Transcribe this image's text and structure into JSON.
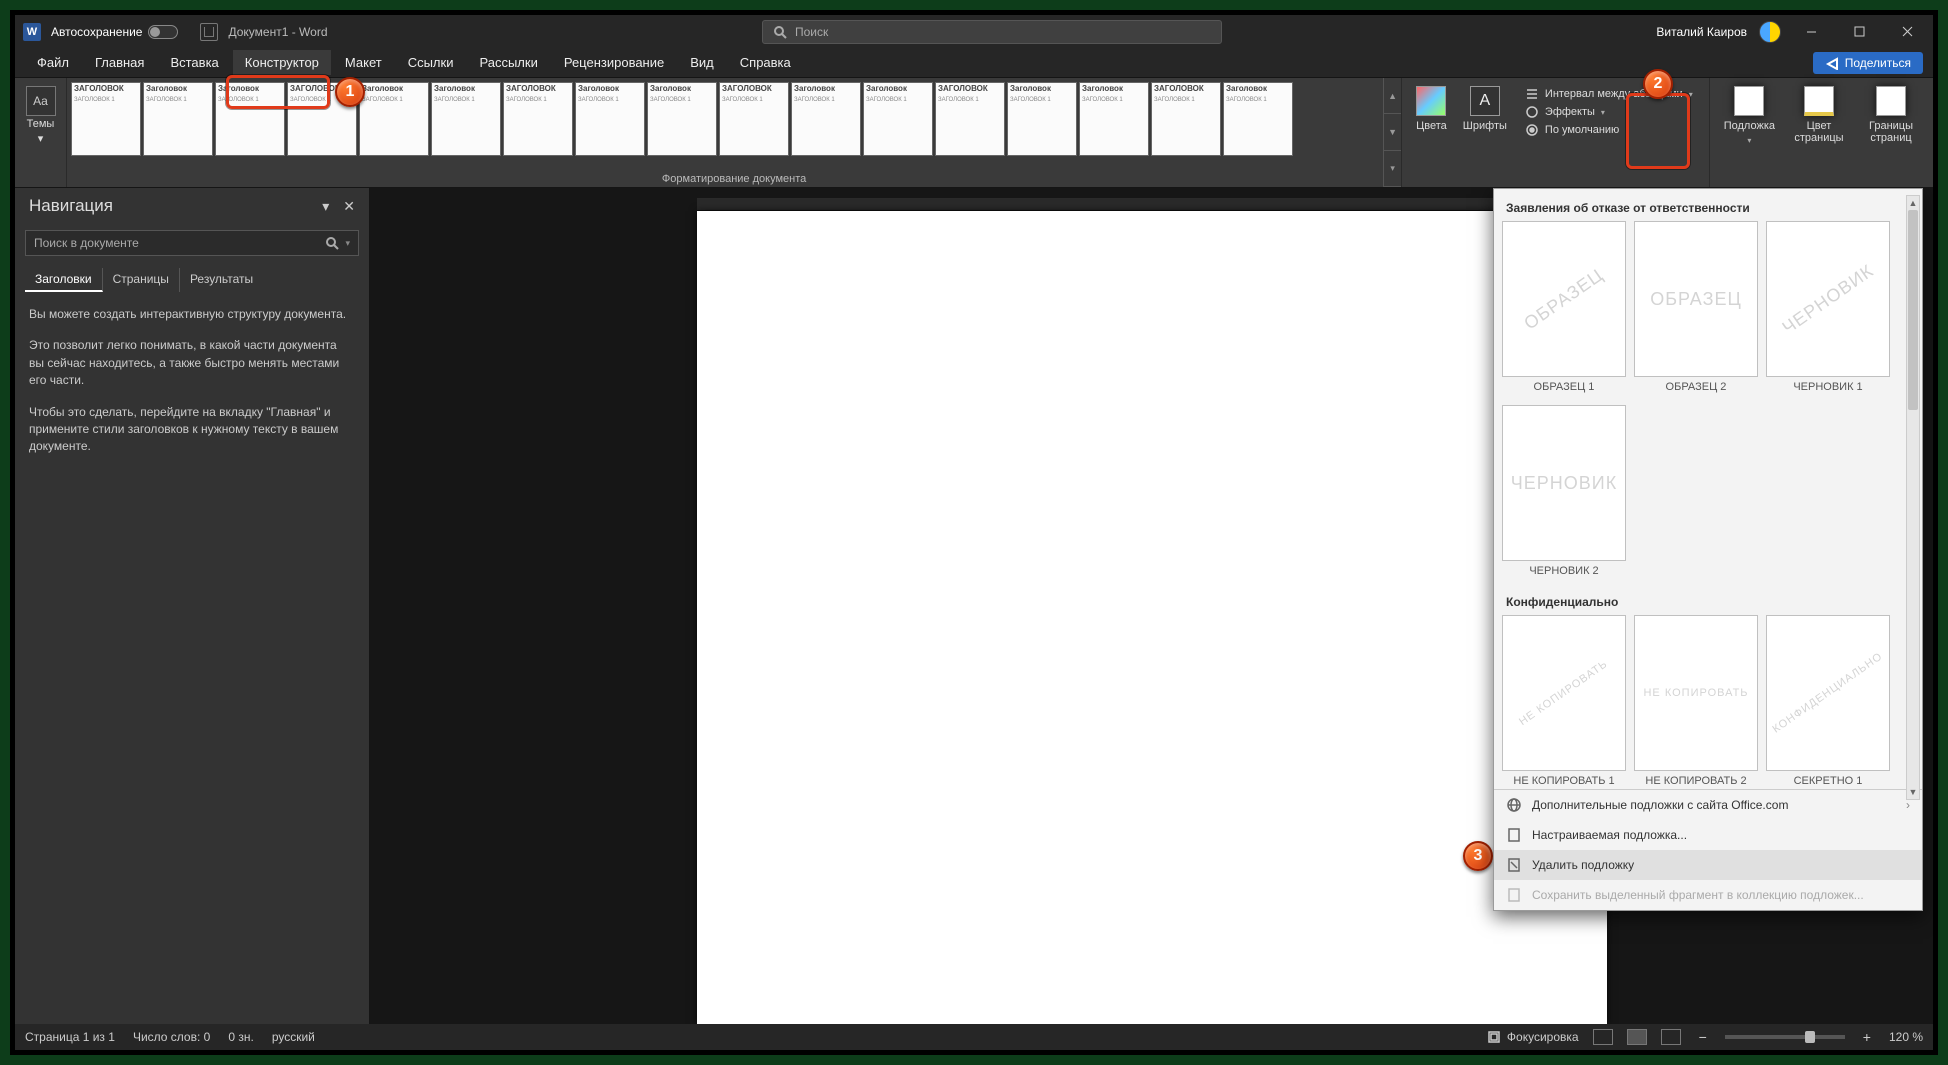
{
  "titlebar": {
    "autosave_label": "Автосохранение",
    "doc_title": "Документ1 - Word",
    "search_placeholder": "Поиск",
    "user_name": "Виталий Каиров"
  },
  "tabs": {
    "file": "Файл",
    "home": "Главная",
    "insert": "Вставка",
    "design": "Конструктор",
    "layout": "Макет",
    "references": "Ссылки",
    "mailings": "Рассылки",
    "review": "Рецензирование",
    "view": "Вид",
    "help": "Справка",
    "share": "Поделиться"
  },
  "ribbon": {
    "themes": "Темы",
    "gallery_heading": "Заголовок",
    "gallery_heading_upper": "ЗАГОЛОВОК",
    "gallery_sub": "ЗАГОЛОВОК 1",
    "gallery_group": "Форматирование документа",
    "colors": "Цвета",
    "fonts": "Шрифты",
    "spacing": "Интервал между абзацами",
    "effects": "Эффекты",
    "default": "По умолчанию",
    "watermark": "Подложка",
    "page_color": "Цвет страницы",
    "page_borders": "Границы страниц"
  },
  "nav": {
    "title": "Навигация",
    "search_placeholder": "Поиск в документе",
    "tab_headings": "Заголовки",
    "tab_pages": "Страницы",
    "tab_results": "Результаты",
    "p1": "Вы можете создать интерактивную структуру документа.",
    "p2": "Это позволит легко понимать, в какой части документа вы сейчас находитесь, а также быстро менять местами его части.",
    "p3": "Чтобы это сделать, перейдите на вкладку \"Главная\" и примените стили заголовков к нужному тексту в вашем документе."
  },
  "dropdown": {
    "section1": "Заявления об отказе от ответственности",
    "section2": "Конфиденциально",
    "items1": [
      {
        "wm": "ОБРАЗЕЦ",
        "label": "ОБРАЗЕЦ 1",
        "diag": true
      },
      {
        "wm": "ОБРАЗЕЦ",
        "label": "ОБРАЗЕЦ 2",
        "diag": false
      },
      {
        "wm": "ЧЕРНОВИК",
        "label": "ЧЕРНОВИК 1",
        "diag": true
      },
      {
        "wm": "ЧЕРНОВИК",
        "label": "ЧЕРНОВИК 2",
        "diag": false
      }
    ],
    "items2": [
      {
        "wm": "НЕ КОПИРОВАТЬ",
        "label": "НЕ КОПИРОВАТЬ 1",
        "diag": true
      },
      {
        "wm": "НЕ КОПИРОВАТЬ",
        "label": "НЕ КОПИРОВАТЬ 2",
        "diag": false
      },
      {
        "wm": "КОНФИДЕНЦИАЛЬНО",
        "label": "СЕКРЕТНО 1",
        "diag": true
      }
    ],
    "more": "Дополнительные подложки с сайта Office.com",
    "custom": "Настраиваемая подложка...",
    "remove": "Удалить подложку",
    "save_sel": "Сохранить выделенный фрагмент в коллекцию подложек..."
  },
  "status": {
    "page": "Страница 1 из 1",
    "words": "Число слов: 0",
    "lang_code": "0 зн.",
    "lang": "русский",
    "focus": "Фокусировка",
    "zoom": "120 %"
  },
  "badges": {
    "b1": "1",
    "b2": "2",
    "b3": "3"
  }
}
